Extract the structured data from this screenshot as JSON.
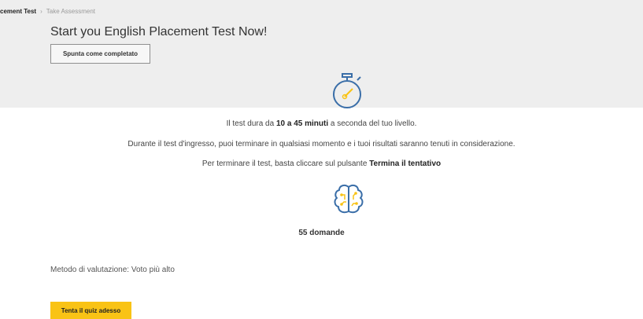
{
  "breadcrumb": {
    "current": "cement Test",
    "separator": "›",
    "page": "Take Assessment"
  },
  "header": {
    "title": "Start you English Placement Test Now!",
    "complete_button_label": "Spunta come completato"
  },
  "icons": {
    "timer": "stopwatch-icon",
    "brain": "brain-icon"
  },
  "info": {
    "line1_prefix": "Il test dura da ",
    "line1_bold": "10 a 45 minuti",
    "line1_suffix": " a seconda del tuo livello.",
    "line2": "Durante il test d'ingresso, puoi terminare in qualsiasi momento e i tuoi risultati saranno tenuti in considerazione.",
    "line3_prefix": "Per terminare il test, basta cliccare sul pulsante ",
    "line3_bold": "Termina il tentativo"
  },
  "quiz": {
    "question_count": "55 domande",
    "grading_method": "Metodo di valutazione: Voto più alto",
    "attempt_button_label": "Tenta il quiz adesso"
  },
  "colors": {
    "accent_blue": "#3a6ea8",
    "accent_yellow": "#f9c315",
    "header_bg": "#eeeeee"
  }
}
